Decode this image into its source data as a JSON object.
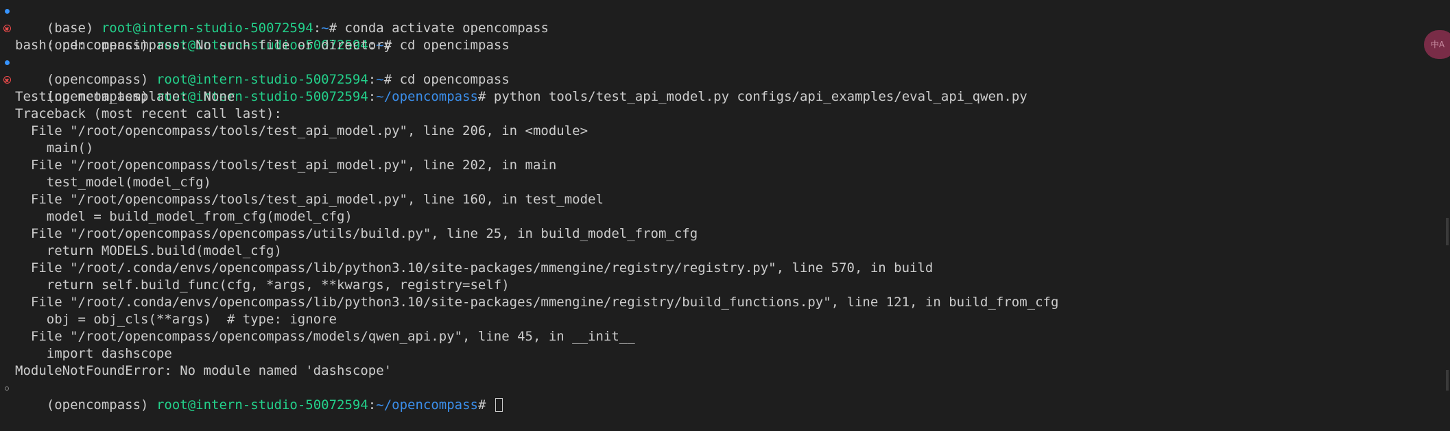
{
  "terminal": {
    "prompts": [
      {
        "env": "(base)",
        "user": "root@intern-studio-50072594",
        "path": "~",
        "command": "conda activate opencompass",
        "status": "success"
      },
      {
        "env": "(opencompass)",
        "user": "root@intern-studio-50072594",
        "path": "~",
        "command": "cd opencimpass",
        "status": "error"
      },
      {
        "env": "(opencompass)",
        "user": "root@intern-studio-50072594",
        "path": "~",
        "command": "cd opencompass",
        "status": "success"
      },
      {
        "env": "(opencompass)",
        "user": "root@intern-studio-50072594",
        "path": "~/opencompass",
        "command": "python tools/test_api_model.py configs/api_examples/eval_api_qwen.py",
        "status": "error"
      },
      {
        "env": "(opencompass)",
        "user": "root@intern-studio-50072594",
        "path": "~/opencompass",
        "command": "",
        "status": "idle"
      }
    ],
    "output_cd_error": "bash: cd: opencimpass: No such file or directory",
    "traceback": [
      "Testing meta_template:  None",
      "Traceback (most recent call last):",
      "  File \"/root/opencompass/tools/test_api_model.py\", line 206, in <module>",
      "    main()",
      "  File \"/root/opencompass/tools/test_api_model.py\", line 202, in main",
      "    test_model(model_cfg)",
      "  File \"/root/opencompass/tools/test_api_model.py\", line 160, in test_model",
      "    model = build_model_from_cfg(model_cfg)",
      "  File \"/root/opencompass/opencompass/utils/build.py\", line 25, in build_model_from_cfg",
      "    return MODELS.build(model_cfg)",
      "  File \"/root/.conda/envs/opencompass/lib/python3.10/site-packages/mmengine/registry/registry.py\", line 570, in build",
      "    return self.build_func(cfg, *args, **kwargs, registry=self)",
      "  File \"/root/.conda/envs/opencompass/lib/python3.10/site-packages/mmengine/registry/build_functions.py\", line 121, in build_from_cfg",
      "    obj = obj_cls(**args)  # type: ignore",
      "  File \"/root/opencompass/opencompass/models/qwen_api.py\", line 45, in __init__",
      "    import dashscope",
      "ModuleNotFoundError: No module named 'dashscope'"
    ],
    "prompt_symbol": "#",
    "colon": ":"
  },
  "badge": {
    "text": "中A"
  },
  "colors": {
    "background": "#1e1e1e",
    "text": "#cccccc",
    "user": "#23d18b",
    "path": "#3b8eea",
    "success_marker": "#3794ff",
    "error_marker": "#f14c4c"
  }
}
